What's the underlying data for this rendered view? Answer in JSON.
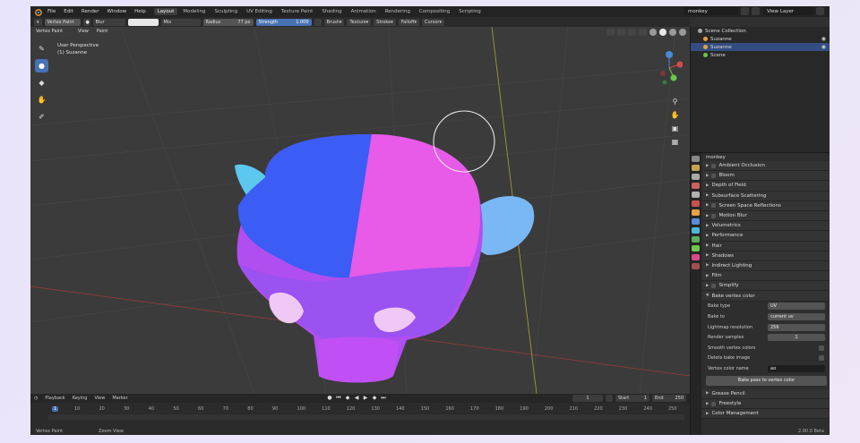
{
  "menubar": {
    "menus": [
      "File",
      "Edit",
      "Render",
      "Window",
      "Help"
    ],
    "workspaces": [
      "Layout",
      "Modeling",
      "Sculpting",
      "UV Editing",
      "Texture Paint",
      "Shading",
      "Animation",
      "Rendering",
      "Compositing",
      "Scripting"
    ],
    "active_workspace": "Layout",
    "scene": "monkey",
    "view_layer": "View Layer"
  },
  "toolheader": {
    "mode": "Vertex Paint",
    "brush": "Blur",
    "blend": "Mix",
    "radius_label": "Radius",
    "radius_value": "77 px",
    "strength_label": "Strength",
    "strength_value": "1.000",
    "menus": [
      "Brush",
      "Texture",
      "Stroke",
      "Falloff",
      "Cursor"
    ]
  },
  "viewport": {
    "mode_button": "Vertex Paint",
    "view_menu": "View",
    "paint_menu": "Paint",
    "info_line1": "User Perspective",
    "info_line2": "(1) Suzanne",
    "colors": {
      "background": "#3a3a3a",
      "grid": "#464646",
      "x_axis": "#8c3a3a",
      "y_axis": "#9a9a3a",
      "head_blue": "#3b5cf5",
      "head_pink": "#e85ae8",
      "ear_cyan": "#5cc8f0",
      "ear_light": "#7ab8f5",
      "face_purple": "#b04ef0",
      "brush_circle": "#e8e8e8"
    }
  },
  "timeline": {
    "menus": [
      "Playback",
      "Keying",
      "View",
      "Marker"
    ],
    "current_frame": "1",
    "start_label": "Start",
    "start_value": "1",
    "end_label": "End",
    "end_value": "250",
    "ticks": [
      "1",
      "10",
      "20",
      "30",
      "40",
      "50",
      "60",
      "70",
      "80",
      "90",
      "100",
      "110",
      "120",
      "130",
      "140",
      "150",
      "160",
      "170",
      "180",
      "190",
      "200",
      "210",
      "220",
      "230",
      "240",
      "250"
    ]
  },
  "statusbar": {
    "left": "Vertex Paint",
    "middle": "Zoom View"
  },
  "outliner": {
    "root": "Scene Collection",
    "items": [
      {
        "label": "Suzanne",
        "selected": false
      },
      {
        "label": "Suzanne",
        "selected": true
      },
      {
        "label": "Scene",
        "selected": false
      }
    ]
  },
  "properties": {
    "object": "monkey",
    "panels": [
      "Ambient Occlusion",
      "Bloom",
      "Depth of Field",
      "Subsurface Scattering",
      "Screen Space Reflections",
      "Motion Blur",
      "Volumetrics",
      "Performance",
      "Hair",
      "Shadows",
      "Indirect Lighting",
      "Film",
      "Simplify",
      "Bake vertex color"
    ],
    "bake": {
      "bake_type_label": "Bake type",
      "bake_type_value": "UV",
      "bake_to_label": "Bake to",
      "bake_to_value": "current uv",
      "lightmap_label": "Lightmap resolution",
      "lightmap_value": "256",
      "render_samples_label": "Render samples",
      "render_samples_value": "1",
      "smooth_label": "Smooth vertex colors",
      "delete_label": "Delete bake image",
      "color_name_label": "Vertex color name",
      "color_name_value": "ao",
      "button": "Bake pass to vertex color"
    },
    "bottom_panels": [
      "Grease Pencil",
      "Freestyle",
      "Color Management"
    ],
    "version": "2.90.0 Beta"
  }
}
